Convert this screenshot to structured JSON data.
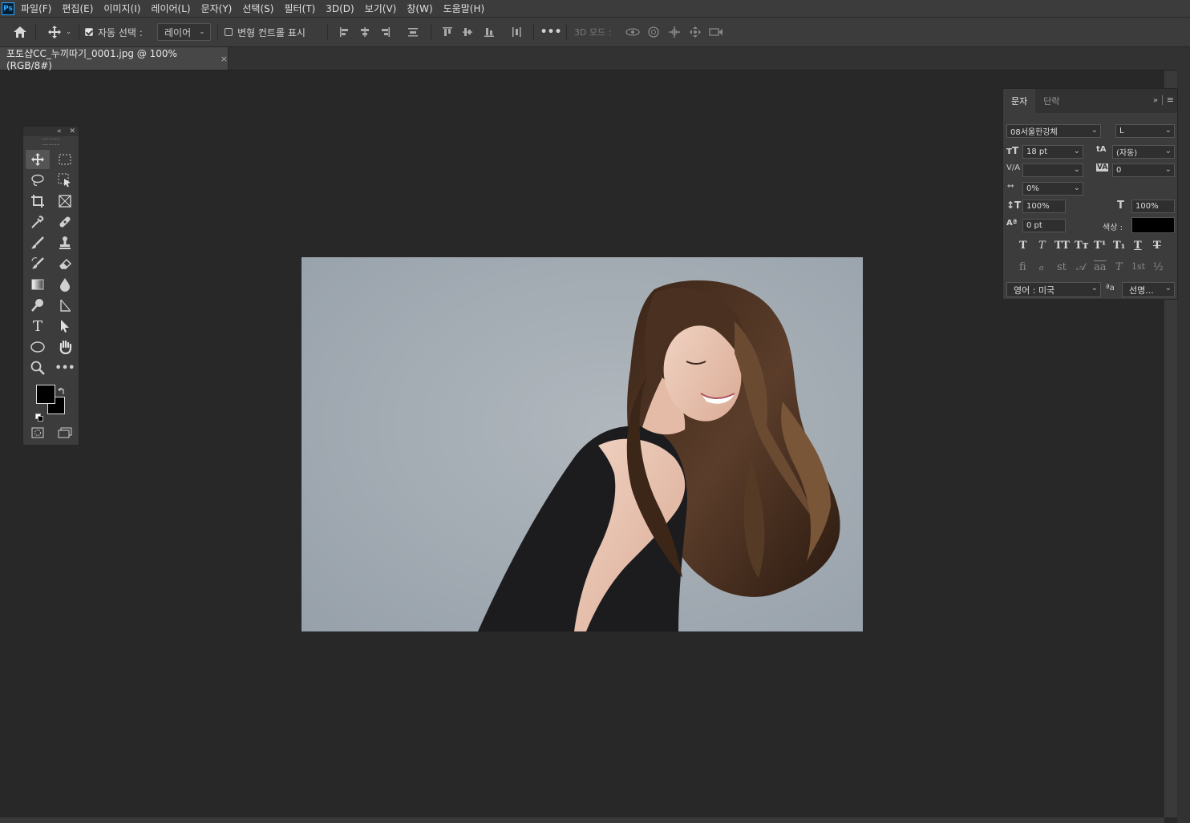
{
  "app": {
    "logo_text": "Ps"
  },
  "menu": [
    "파일(F)",
    "편집(E)",
    "이미지(I)",
    "레이어(L)",
    "문자(Y)",
    "선택(S)",
    "필터(T)",
    "3D(D)",
    "보기(V)",
    "창(W)",
    "도움말(H)"
  ],
  "options": {
    "auto_select_label": "자동 선택 :",
    "auto_select_value": "레이어",
    "transform_controls_label": "변형 컨트롤 표시",
    "mode_3d_label": "3D 모드 :"
  },
  "document": {
    "tab_title": "포토샵CC_누끼따기_0001.jpg @ 100% (RGB/8#)",
    "close_glyph": "×"
  },
  "colors": {
    "foreground": "#000000",
    "background": "#000000",
    "accent": "#31a8ff"
  },
  "character_panel": {
    "tabs": [
      "문자",
      "단락"
    ],
    "font_family": "08서울한강체",
    "font_style": "L",
    "font_size": "18 pt",
    "leading": "(자동)",
    "kerning": "",
    "tracking": "0",
    "tsume": "0%",
    "vertical_scale": "100%",
    "horizontal_scale": "100%",
    "baseline_shift": "0 pt",
    "color_label": "색상 :",
    "text_color": "#000000",
    "style_buttons": [
      "T",
      "T",
      "TT",
      "Tт",
      "T¹",
      "T₁",
      "T",
      "T"
    ],
    "opentype_buttons": [
      "fi",
      "ℴ",
      "st",
      "𝒜",
      "aa",
      "T",
      "1st",
      "½"
    ],
    "language": "영어 : 미국",
    "antialias_icon": "ªa",
    "antialias": "선명..."
  }
}
